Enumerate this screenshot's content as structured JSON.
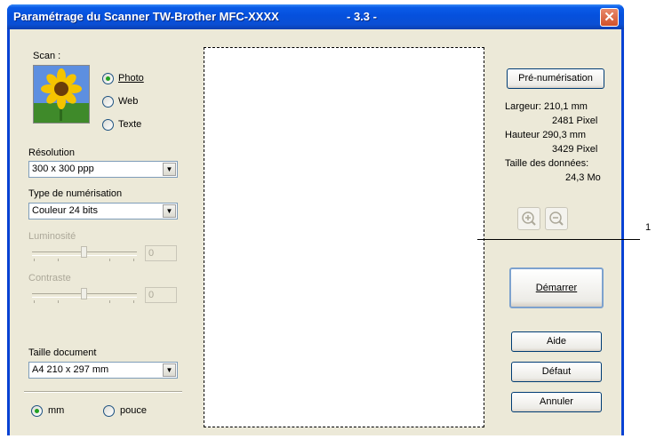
{
  "window": {
    "title": "Paramétrage du Scanner TW-Brother MFC-XXXX",
    "version": "- 3.3 -",
    "close_symbol": "✕"
  },
  "scan": {
    "label": "Scan :",
    "options": [
      {
        "label": "Photo",
        "checked": true
      },
      {
        "label": "Web",
        "checked": false
      },
      {
        "label": "Texte",
        "checked": false
      }
    ]
  },
  "resolution": {
    "label": "Résolution",
    "value": "300 x 300 ppp"
  },
  "scan_type": {
    "label": "Type de numérisation",
    "value": "Couleur 24 bits"
  },
  "brightness": {
    "label": "Luminosité",
    "value": "0"
  },
  "contrast": {
    "label": "Contraste",
    "value": "0"
  },
  "doc_size": {
    "label": "Taille document",
    "value": "A4 210 x 297 mm"
  },
  "units": [
    {
      "label": "mm",
      "checked": true
    },
    {
      "label": "pouce",
      "checked": false
    }
  ],
  "prescan_label": "Pré-numérisation",
  "info": {
    "width_label": "Largeur: 210,1 mm",
    "width_px": "2481 Pixel",
    "height_label": "Hauteur 290,3 mm",
    "height_px": "3429 Pixel",
    "data_label": "Taille des données:",
    "data_value": "24,3 Mo"
  },
  "buttons": {
    "start": "Démarrer",
    "help": "Aide",
    "default": "Défaut",
    "cancel": "Annuler"
  },
  "callout": "1"
}
